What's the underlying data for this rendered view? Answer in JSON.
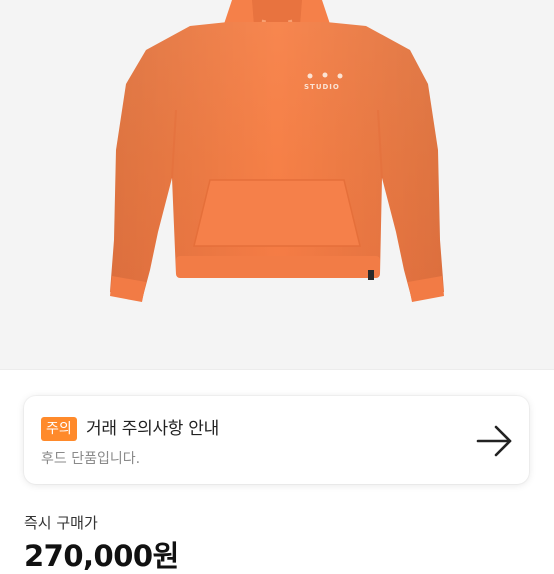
{
  "product": {
    "image_icon": "orange-hoodie-photo",
    "print_text": "STUDIO",
    "colors": {
      "garment": "#f7834f",
      "background": "#f4f4f4"
    }
  },
  "notice": {
    "badge": "주의",
    "title": "거래 주의사항 안내",
    "subtitle": "후드 단품입니다.",
    "arrow_icon": "arrow-right-icon",
    "badge_color": "#ff8a2b"
  },
  "purchase": {
    "label": "즉시 구매가",
    "price": "270,000원"
  }
}
